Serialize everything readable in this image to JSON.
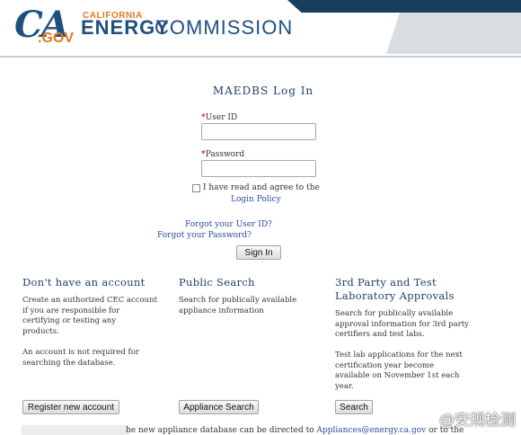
{
  "header": {
    "logo_ca": "CA",
    "logo_gov": ".GOV",
    "logo_california": "CALIFORNIA",
    "logo_energy": "ENERGY",
    "logo_commission": "COMMISSION"
  },
  "login": {
    "title": "MAEDBS Log In",
    "user_id_label": "User ID",
    "password_label": "Password",
    "required_marker": "*",
    "agree_text": "I have read and agree to the",
    "login_policy_link": "Login Policy",
    "forgot_user_id": "Forgot your User ID?",
    "forgot_password": "Forgot your Password?",
    "sign_in_button": "Sign In"
  },
  "columns": {
    "account": {
      "title": "Don't have an account",
      "text1": "Create an authorized CEC account\nif you are responsible for\ncertifying or testing any\nproducts.",
      "text2": "An account is not required for\nsearching the database.",
      "button": "Register new account"
    },
    "public_search": {
      "title": "Public Search",
      "text1": "Search for publically available\nappliance information",
      "button": "Appliance Search"
    },
    "third_party": {
      "title": "3rd Party and Test\nLaboratory Approvals",
      "text1": "Search for publically available\napproval information for 3rd party\ncertifiers and test labs.",
      "text2": "Test lab applications for the next\ncertification year become\navailable on November 1st each\nyear.",
      "button": "Search"
    }
  },
  "footer": {
    "text": "he new appliance database can be directed to ",
    "email_link": "Appliances@energy.ca.gov",
    "text_after": " or to the"
  },
  "watermark": "@安规检测",
  "colors": {
    "brand_blue": "#1f4f7f",
    "brand_orange": "#e2791f",
    "link": "#2b4e9b",
    "required": "#cc2222"
  }
}
